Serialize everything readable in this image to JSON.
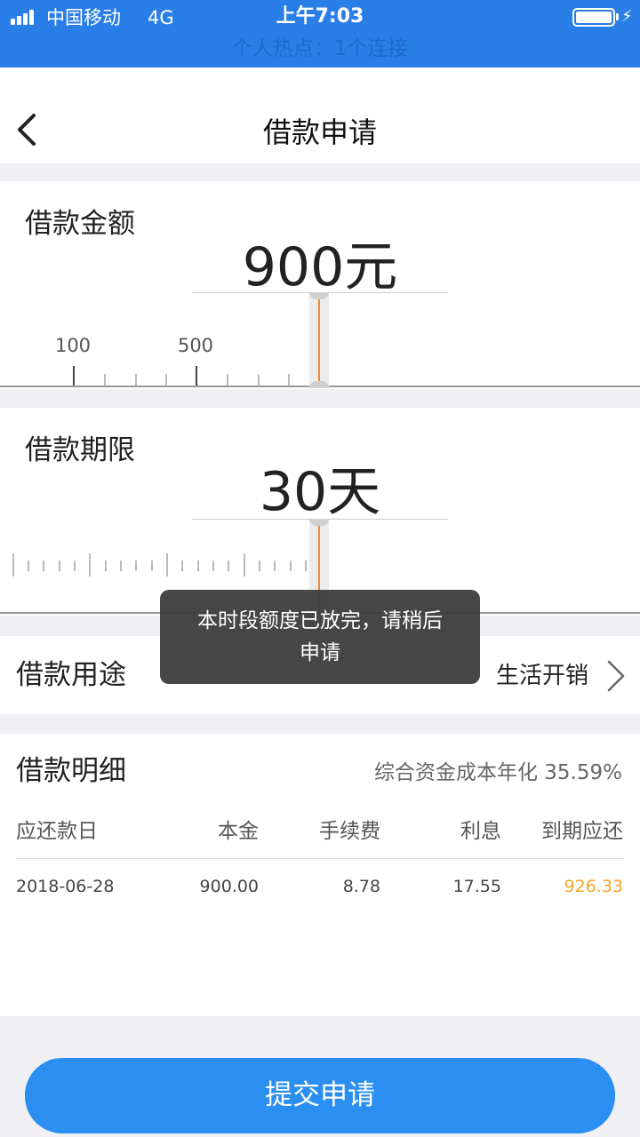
{
  "status_bar": {
    "carrier": "中国移动",
    "network": "4G",
    "time": "上午7:03",
    "hotspot": "个人热点：1个连接"
  },
  "nav": {
    "title": "借款申请"
  },
  "amount": {
    "label": "借款金额",
    "value": "900元",
    "tick_labels": [
      "100",
      "500"
    ]
  },
  "term": {
    "label": "借款期限",
    "value": "30天"
  },
  "purpose": {
    "label": "借款用途",
    "value": "生活开销"
  },
  "toast": {
    "line1": "本时段额度已放完，请稍后",
    "line2": "申请"
  },
  "detail": {
    "title": "借款明细",
    "rate": "综合资金成本年化 35.59%",
    "columns": [
      "应还款日",
      "本金",
      "手续费",
      "利息",
      "到期应还"
    ],
    "row": [
      "2018-06-28",
      "900.00",
      "8.78",
      "17.55",
      "926.33"
    ]
  },
  "submit": {
    "label": "提交申请"
  },
  "colors": {
    "brand_blue": "#2a7ee8",
    "button_blue": "#2a8ff0",
    "indicator_orange": "#f08a2c",
    "due_amount": "#f5a623"
  }
}
